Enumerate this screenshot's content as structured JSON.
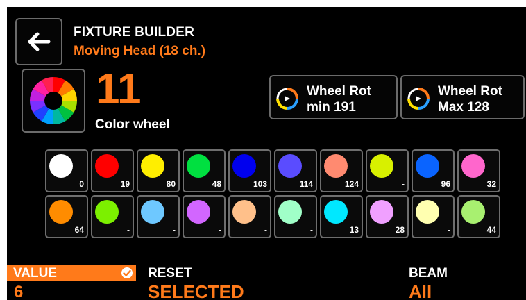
{
  "header": {
    "title": "FIXTURE BUILDER",
    "subtitle": "Moving Head (18 ch.)",
    "back_icon": "arrow-left-icon"
  },
  "wheel": {
    "number": "11",
    "label": "Color wheel",
    "icon": "color-wheel-icon"
  },
  "rotation": [
    {
      "icon": "rotation-icon",
      "line1": "Wheel Rot",
      "line2": "min 191"
    },
    {
      "icon": "rotation-icon",
      "line1": "Wheel Rot",
      "line2": "Max 128"
    }
  ],
  "colors": [
    {
      "color": "#ffffff",
      "value": "0"
    },
    {
      "color": "#ff0000",
      "value": "19"
    },
    {
      "color": "#ffee00",
      "value": "80"
    },
    {
      "color": "#00e040",
      "value": "48"
    },
    {
      "color": "#0000ee",
      "value": "103"
    },
    {
      "color": "#5a4cff",
      "value": "114"
    },
    {
      "color": "#ff8a70",
      "value": "124"
    },
    {
      "color": "#d8f000",
      "value": "-"
    },
    {
      "color": "#0a64ff",
      "value": "96"
    },
    {
      "color": "#ff66cc",
      "value": "32"
    },
    {
      "color": "#ff8c00",
      "value": "64"
    },
    {
      "color": "#7cf000",
      "value": "-"
    },
    {
      "color": "#6ec8ff",
      "value": "-"
    },
    {
      "color": "#d266ff",
      "value": "-"
    },
    {
      "color": "#ffc08a",
      "value": "-"
    },
    {
      "color": "#a0ffc8",
      "value": "-"
    },
    {
      "color": "#00e8ff",
      "value": "13"
    },
    {
      "color": "#f0a0ff",
      "value": "28"
    },
    {
      "color": "#ffffb0",
      "value": "-"
    },
    {
      "color": "#a8f070",
      "value": "44"
    }
  ],
  "footer": {
    "value_label": "VALUE",
    "value": "6",
    "check_icon": "check-circle-icon",
    "reset_label": "RESET",
    "reset_value": "SELECTED",
    "beam_label": "BEAM",
    "beam_value": "All"
  },
  "accent_color": "#ff7a1a"
}
